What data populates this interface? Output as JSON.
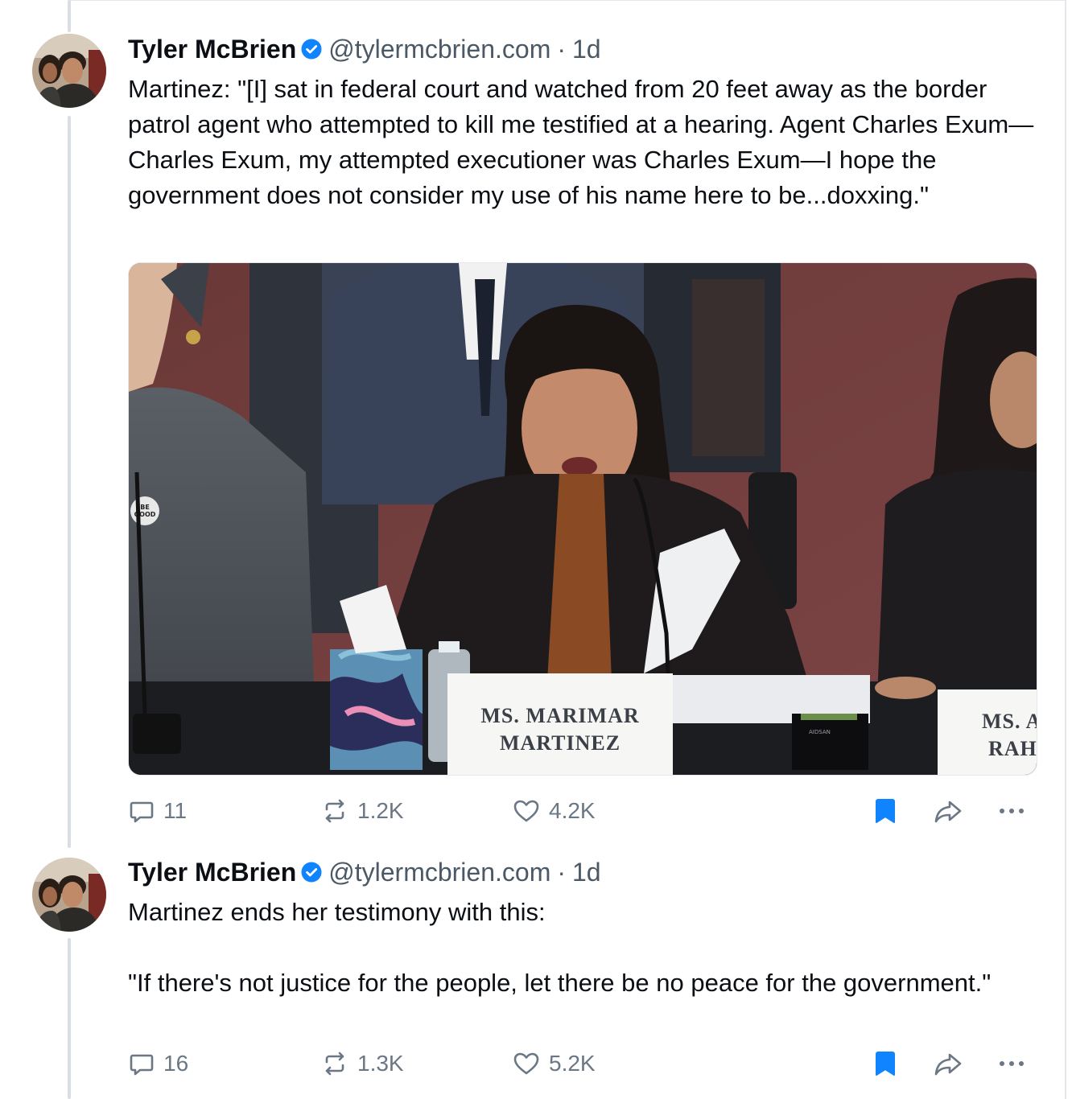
{
  "posts": [
    {
      "author_name": "Tyler McBrien",
      "handle": "@tylermcbrien.com",
      "separator": "·",
      "time": "1d",
      "text": "Martinez: \"[I] sat in federal court and watched from 20 feet away as the border patrol agent who attempted to kill me testified at a hearing. Agent Charles Exum—Charles Exum, my attempted executioner was Charles Exum—I hope the government does not consider my use of his name here to be...doxxing.\"",
      "image": {
        "placard_line1": "MS. MARIMAR",
        "placard_line2": "MARTINEZ",
        "placard2_line1": "MS. A",
        "placard2_line2": "RAH",
        "button_pin": "BE GOOD",
        "device_label": "AIDSAN"
      },
      "replies": "11",
      "reposts": "1.2K",
      "likes": "4.2K"
    },
    {
      "author_name": "Tyler McBrien",
      "handle": "@tylermcbrien.com",
      "separator": "·",
      "time": "1d",
      "text": "Martinez ends her testimony with this:\n\n\"If there's not justice for the people, let there be no peace for the government.\"",
      "replies": "16",
      "reposts": "1.3K",
      "likes": "5.2K"
    }
  ],
  "colors": {
    "verified": "#1083fe",
    "bookmark_active": "#1083fe",
    "muted": "#6b7785",
    "thread_line": "#d9dee4"
  },
  "icons": [
    "reply-icon",
    "repost-icon",
    "like-icon",
    "bookmark-icon",
    "share-icon",
    "more-icon",
    "verified-icon"
  ]
}
